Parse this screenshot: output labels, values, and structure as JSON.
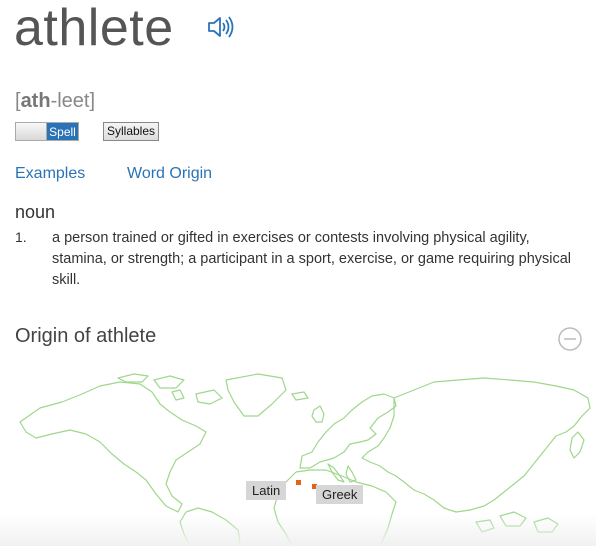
{
  "entry": {
    "word": "athlete",
    "pronunciation": {
      "open": "[",
      "stressed": "ath",
      "rest": "-leet",
      "close": "]"
    },
    "spell_toggle_label": "Spell",
    "syllables_label": "Syllables",
    "tabs": [
      "Examples",
      "Word Origin"
    ],
    "part_of_speech": "noun",
    "definitions": [
      {
        "number": "1.",
        "text": "a person trained or gifted in exercises or contests involving physical agility, stamina, or strength; a participant in a sport, exercise, or game requiring physical skill."
      }
    ]
  },
  "origin": {
    "title": "Origin of athlete",
    "map_labels": [
      "Latin",
      "Greek"
    ]
  },
  "colors": {
    "link": "#2b73b7",
    "map_outline": "#9ed78c",
    "marker": "#e2631b"
  },
  "icons": [
    "speaker-icon",
    "collapse-icon"
  ]
}
